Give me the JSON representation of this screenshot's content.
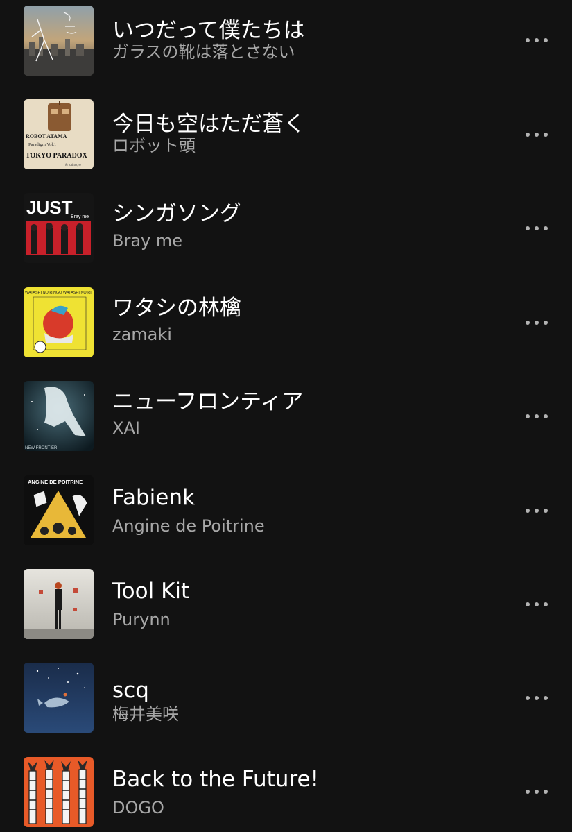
{
  "tracks": [
    {
      "title": "いつだって僕たちは",
      "artist": "ガラスの靴は落とさない",
      "cover_icon": "city-skyline-sketch-cover",
      "more_icon": "more-horizontal-icon"
    },
    {
      "title": "今日も空はただ蒼く",
      "artist": "ロボット頭",
      "cover_icon": "robot-head-cover",
      "cover_text": {
        "line1": "ROBOT ATAMA",
        "line2": "Paradigm Vol.1",
        "line3": "TOKYO PARADOX",
        "line4": "& kaitokyo"
      },
      "more_icon": "more-horizontal-icon"
    },
    {
      "title": "シンガソング",
      "artist": "Bray me",
      "cover_icon": "band-photo-cover",
      "cover_text": {
        "line1": "JUST",
        "line2": "Bray me"
      },
      "more_icon": "more-horizontal-icon"
    },
    {
      "title": "ワタシの林檎",
      "artist": "zamaki",
      "cover_icon": "apple-illustration-cover",
      "cover_text": {
        "line1": "WATASHI NO RINGO  WATASHI NO RI"
      },
      "more_icon": "more-horizontal-icon"
    },
    {
      "title": "ニューフロンティア",
      "artist": "XAI",
      "cover_icon": "floating-figure-cover",
      "cover_text": {
        "line1": "NEW FRONTIER"
      },
      "more_icon": "more-horizontal-icon"
    },
    {
      "title": "Fabienk",
      "artist": "Angine de Poitrine",
      "cover_icon": "pyramid-band-cover",
      "cover_text": {
        "line1": "ANGINE DE POITRINE"
      },
      "more_icon": "more-horizontal-icon"
    },
    {
      "title": "Tool Kit",
      "artist": "Purynn",
      "cover_icon": "standing-woman-cover",
      "more_icon": "more-horizontal-icon"
    },
    {
      "title": "scq",
      "artist": "梅井美咲",
      "cover_icon": "whale-night-cover",
      "more_icon": "more-horizontal-icon"
    },
    {
      "title": "Back to the Future!",
      "artist": "DOGO",
      "cover_icon": "zebra-figures-cover",
      "more_icon": "more-horizontal-icon"
    }
  ],
  "colors": {
    "background": "#121212",
    "title": "#ffffff",
    "artist": "#a7a7a7",
    "more_dots": "#b3b3b3"
  }
}
